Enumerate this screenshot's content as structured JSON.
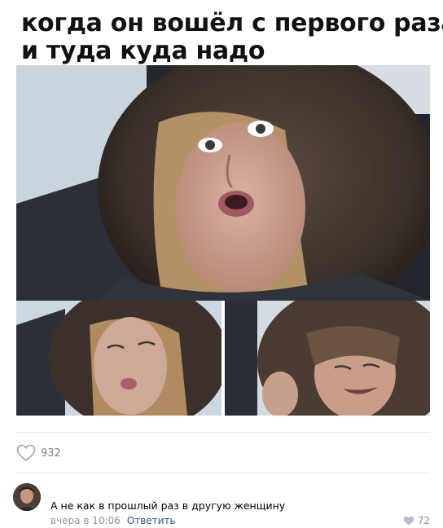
{
  "post": {
    "meme_caption_lines": [
      "когда он вошёл с первого раза",
      "и туда куда  надо"
    ],
    "likes": {
      "icon": "heart-outline-icon",
      "count": "932"
    }
  },
  "comment": {
    "text": "А не как в прошлый раз в другую женщину",
    "time": "вчера в 10:06",
    "reply_label": "Ответить",
    "likes_icon": "heart-filled-icon",
    "likes_count": "72"
  },
  "colors": {
    "link": "#2a5885",
    "meta": "#939393",
    "divider": "#e7e8ec",
    "like_gray": "#828282"
  }
}
